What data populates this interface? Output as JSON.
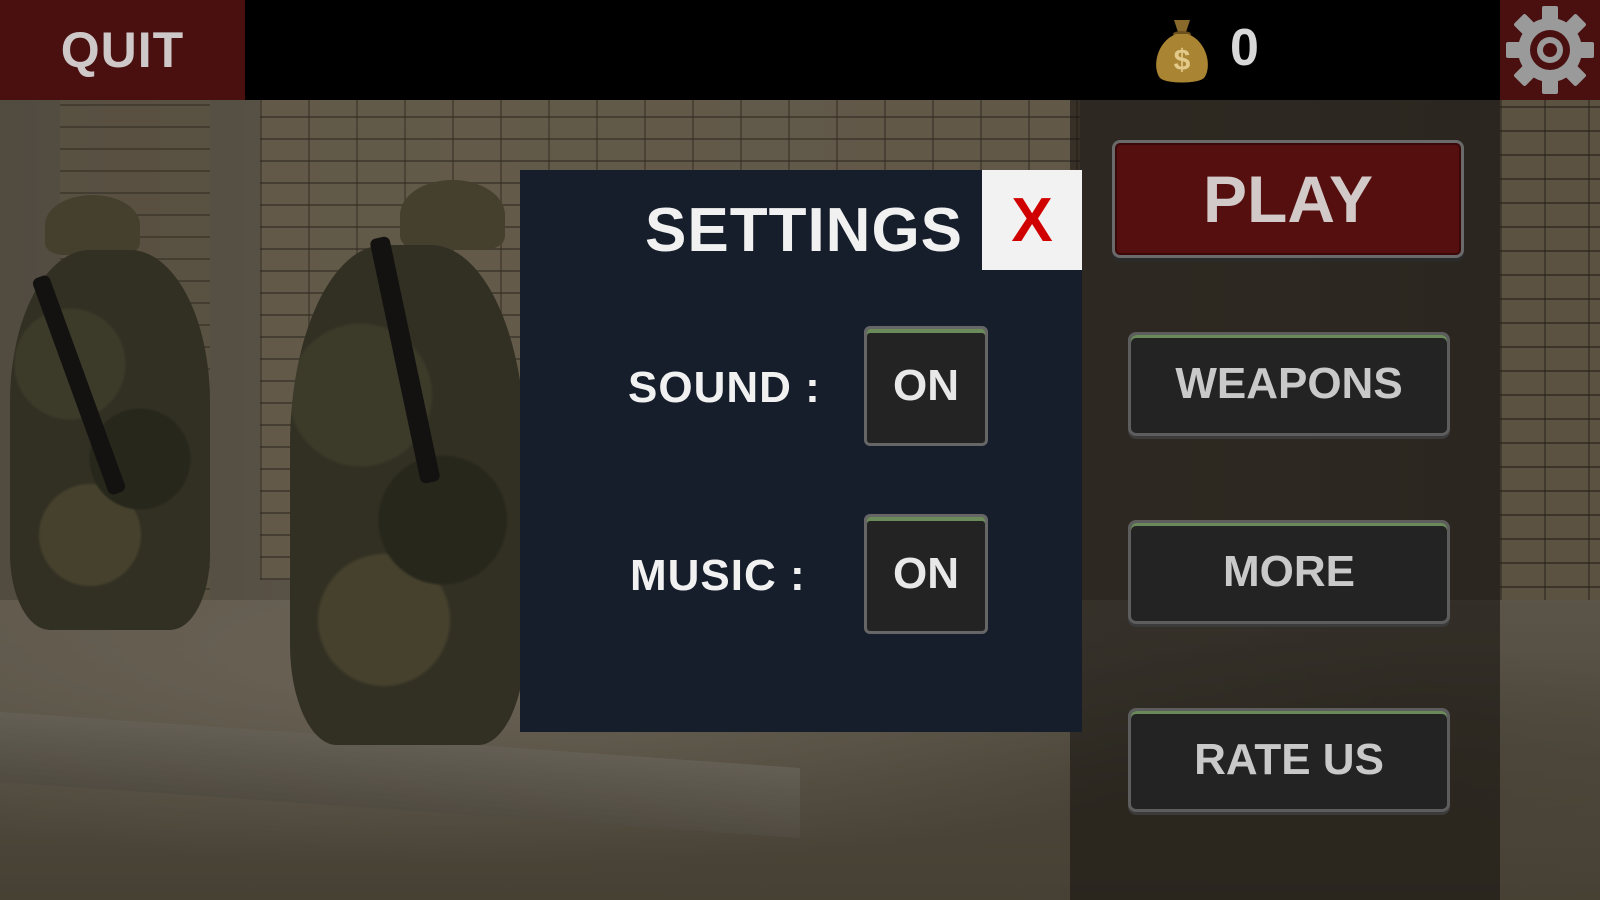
{
  "top_bar": {
    "quit_label": "QUIT",
    "coins": "0",
    "coin_icon": "money-bag-icon",
    "settings_icon": "gear-icon"
  },
  "menu": {
    "play_label": "PLAY",
    "weapons_label": "WEAPONS",
    "more_label": "MORE",
    "rate_label": "RATE US"
  },
  "settings": {
    "title": "SETTINGS",
    "close_label": "X",
    "sound_label": "SOUND :",
    "sound_value": "ON",
    "music_label": "MUSIC :",
    "music_value": "ON"
  },
  "colors": {
    "accent_red": "#560f0f",
    "dialog_bg": "#161d2b",
    "close_x": "#d10000"
  }
}
